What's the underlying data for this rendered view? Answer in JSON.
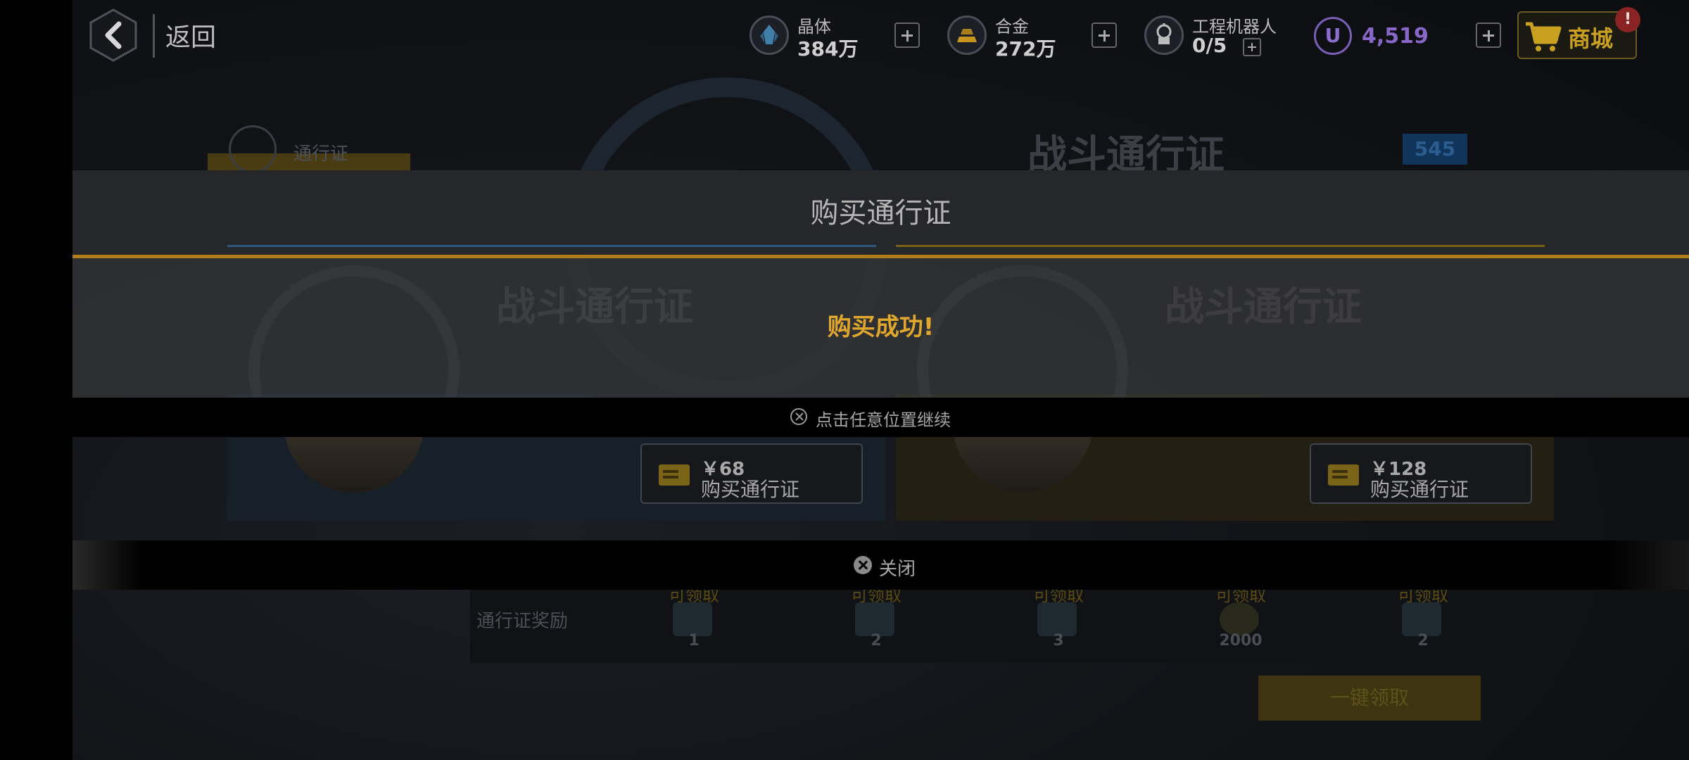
{
  "header": {
    "back_label": "返回",
    "resources": [
      {
        "name": "晶体",
        "value": "384万",
        "icon": "crystal-icon"
      },
      {
        "name": "合金",
        "value": "272万",
        "icon": "alloy-ingot-icon"
      },
      {
        "name": "工程机器人",
        "value": "0/5",
        "icon": "robot-icon"
      }
    ],
    "currency_symbol": "U",
    "currency_value": "4,519",
    "shop_label": "商城",
    "notification_badge": "!"
  },
  "background": {
    "pass_tab_label": "通行证",
    "page_title": "战斗通行证",
    "level": "545",
    "cards": [
      {
        "price": "￥68",
        "buy_label": "购买通行证"
      },
      {
        "price": "￥128",
        "buy_label": "购买通行证"
      }
    ],
    "close_label": "关闭",
    "rewards_label": "通行证奖励",
    "rewards": [
      {
        "status": "可领取",
        "qty": "1"
      },
      {
        "status": "可领取",
        "qty": "2"
      },
      {
        "status": "可领取",
        "qty": "3"
      },
      {
        "status": "可领取",
        "qty": "2000"
      },
      {
        "status": "可领取",
        "qty": "2"
      }
    ],
    "claim_all_label": "一键领取"
  },
  "popup": {
    "title": "购买通行证",
    "ghost_title": "战斗通行证",
    "message": "购买成功!",
    "continue_label": "点击任意位置继续"
  },
  "colors": {
    "accent_gold": "#b07d1a",
    "success_text": "#e0a72c",
    "currency_purple": "#8867c9",
    "shop_gold": "#c9a020"
  }
}
